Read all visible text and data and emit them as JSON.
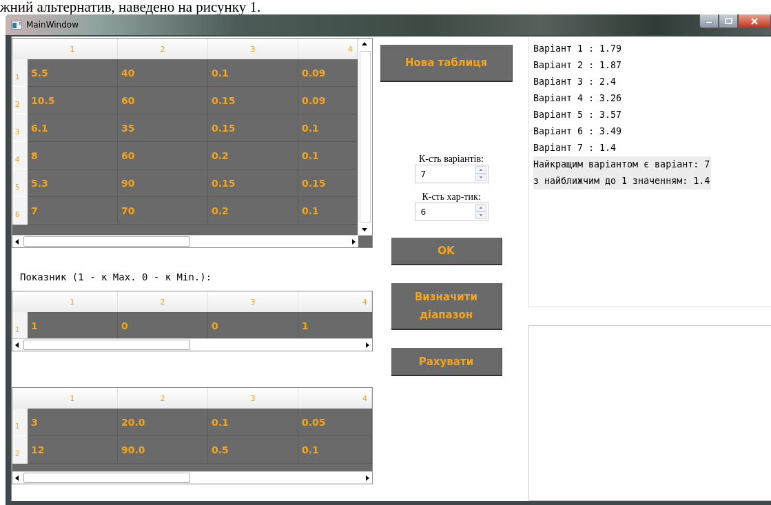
{
  "document_text": "жний альтернатив, наведено на рисунку 1.",
  "window": {
    "title": "MainWindow"
  },
  "criteria_table": {
    "vertical_scrollbar": true,
    "columns": [
      "1",
      "2",
      "3",
      "4"
    ],
    "rows": [
      {
        "header": "1",
        "cells": [
          "5.5",
          "40",
          "0.1",
          "0.09"
        ]
      },
      {
        "header": "2",
        "cells": [
          "10.5",
          "60",
          "0.15",
          "0.09"
        ]
      },
      {
        "header": "3",
        "cells": [
          "6.1",
          "35",
          "0.15",
          "0.1"
        ]
      },
      {
        "header": "4",
        "cells": [
          "8",
          "60",
          "0.2",
          "0.1"
        ]
      },
      {
        "header": "5",
        "cells": [
          "5.3",
          "90",
          "0.15",
          "0.15"
        ]
      },
      {
        "header": "6",
        "cells": [
          "7",
          "70",
          "0.2",
          "0.1"
        ]
      }
    ]
  },
  "direction_label": "Показник (1 - к Max. 0 - к Min.):",
  "direction_table": {
    "vertical_scrollbar": false,
    "columns": [
      "1",
      "2",
      "3",
      "4"
    ],
    "rows": [
      {
        "header": "1",
        "cells": [
          "1",
          "0",
          "0",
          "1"
        ]
      }
    ]
  },
  "range_table": {
    "vertical_scrollbar": false,
    "columns": [
      "1",
      "2",
      "3",
      "4"
    ],
    "rows": [
      {
        "header": "1",
        "cells": [
          "3",
          "20.0",
          "0.1",
          "0.05"
        ]
      },
      {
        "header": "2",
        "cells": [
          "12",
          "90.0",
          "0.5",
          "0.1"
        ]
      }
    ]
  },
  "new_table_button": "Нова таблиця",
  "variants": {
    "label": "К-сть варіантів:",
    "value": "7"
  },
  "characteristics": {
    "label": "К-сть хар-тик:",
    "value": "6"
  },
  "ok_button": "OK",
  "range_button": "Визначити діапазон",
  "calculate_button": "Рахувати",
  "results": [
    {
      "text": "Варіант 1 : 1.79",
      "highlighted": false
    },
    {
      "text": "Варіант 2 : 1.87",
      "highlighted": false
    },
    {
      "text": "Варіант 3 : 2.4",
      "highlighted": false
    },
    {
      "text": "Варіант 4 : 3.26",
      "highlighted": false
    },
    {
      "text": "Варіант 5 : 3.57",
      "highlighted": false
    },
    {
      "text": "Варіант 6 : 3.49",
      "highlighted": false
    },
    {
      "text": "Варіант 7 : 1.4",
      "highlighted": false
    },
    {
      "text": "Найкращим варіантом є варіант: 7",
      "highlighted": true
    },
    {
      "text": "з найближчим до 1 значенням: 1.4",
      "highlighted": true
    }
  ]
}
